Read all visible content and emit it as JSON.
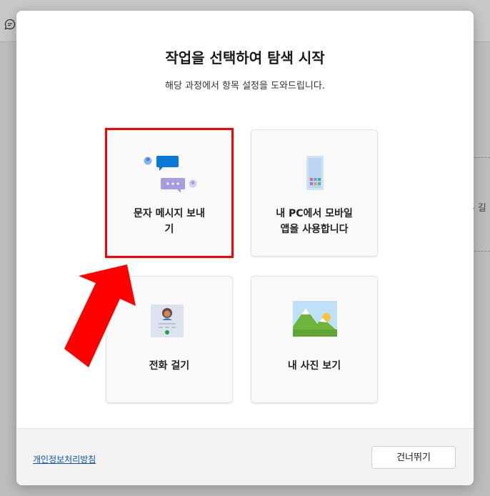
{
  "dialog": {
    "title": "작업을 선택하여 탐색 시작",
    "subtitle": "해당 과정에서 항목 설정을 도와드립니다."
  },
  "cards": [
    {
      "line1": "문자 메시지 보내",
      "line2": "기",
      "icon": "messaging-icon"
    },
    {
      "line1": "내 PC에서 모바일",
      "line2": "앱을 사용합니다",
      "icon": "phone-apps-icon"
    },
    {
      "line1": "전화 걸기",
      "icon": "contact-call-icon"
    },
    {
      "line1": "내 사진 보기",
      "icon": "landscape-photo-icon"
    }
  ],
  "footer": {
    "privacy_link": "개인정보처리방침",
    "skip_button": "건너뛰기"
  },
  "background": {
    "side_text": "- 길"
  },
  "colors": {
    "highlight": "#ff0000",
    "arrow": "#ff0000",
    "accent_blue": "#0a78d4",
    "accent_purple": "#a89be0",
    "link": "#0b56b8"
  }
}
